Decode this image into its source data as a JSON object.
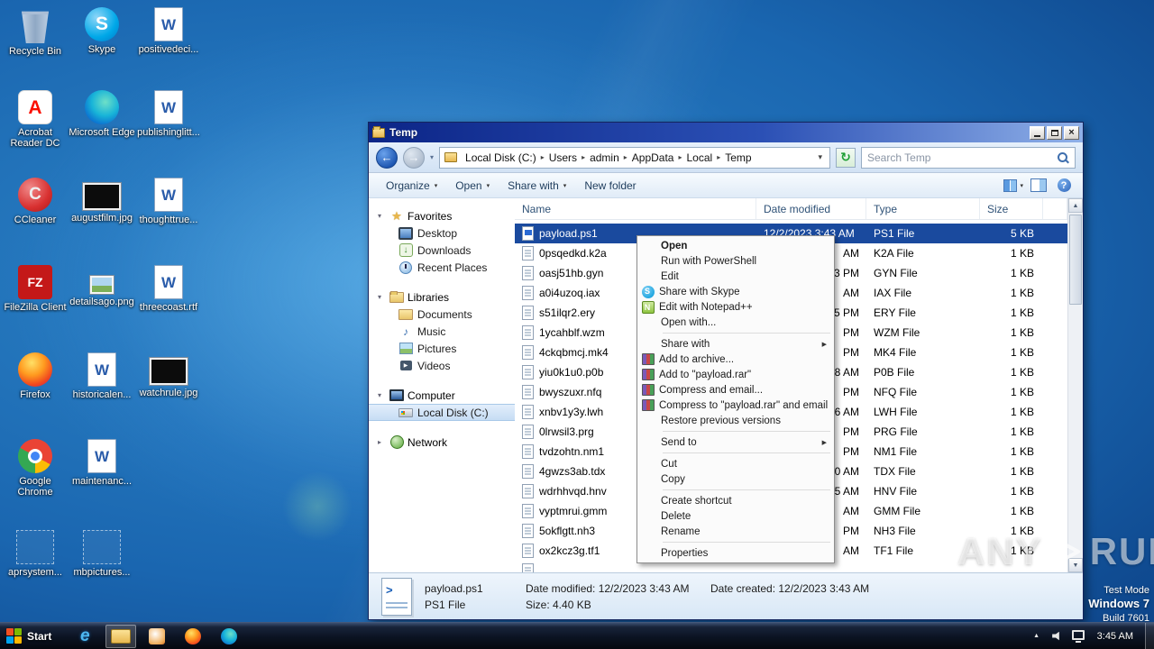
{
  "colors": {
    "selection": "#1a4a9e",
    "titlebar_left": "#0c2587",
    "titlebar_right": "#8fb0e8",
    "taskbar": "#0b1322"
  },
  "desktop": {
    "icons": [
      {
        "label": "Recycle Bin",
        "kind": "recycle",
        "col": 0,
        "row": 0
      },
      {
        "label": "Skype",
        "kind": "skype",
        "col": 1,
        "row": 0
      },
      {
        "label": "positivedeci...",
        "kind": "word",
        "col": 2,
        "row": 0
      },
      {
        "label": "Acrobat Reader DC",
        "kind": "acrobat",
        "col": 0,
        "row": 1
      },
      {
        "label": "Microsoft Edge",
        "kind": "edge",
        "col": 1,
        "row": 1
      },
      {
        "label": "publishinglitt...",
        "kind": "word",
        "col": 2,
        "row": 1
      },
      {
        "label": "CCleaner",
        "kind": "ccleaner",
        "col": 0,
        "row": 2
      },
      {
        "label": "augustfilm.jpg",
        "kind": "imgblack",
        "col": 1,
        "row": 2
      },
      {
        "label": "thoughttrue...",
        "kind": "word",
        "col": 2,
        "row": 2
      },
      {
        "label": "FileZilla Client",
        "kind": "filezilla",
        "col": 0,
        "row": 3
      },
      {
        "label": "detailsago.png",
        "kind": "imgsmall",
        "col": 1,
        "row": 3
      },
      {
        "label": "threecoast.rtf",
        "kind": "word",
        "col": 2,
        "row": 3
      },
      {
        "label": "Firefox",
        "kind": "firefox",
        "col": 0,
        "row": 4
      },
      {
        "label": "historicalen...",
        "kind": "word",
        "col": 1,
        "row": 4
      },
      {
        "label": "watchrule.jpg",
        "kind": "imgblack",
        "col": 2,
        "row": 4
      },
      {
        "label": "Google Chrome",
        "kind": "chrome",
        "col": 0,
        "row": 5
      },
      {
        "label": "maintenanc...",
        "kind": "word",
        "col": 1,
        "row": 5
      },
      {
        "label": "aprsystem...",
        "kind": "ghost",
        "col": 0,
        "row": 6
      },
      {
        "label": "mbpictures...",
        "kind": "ghost",
        "col": 1,
        "row": 6
      }
    ]
  },
  "window": {
    "title": "Temp",
    "controls": [
      "minimize",
      "maximize",
      "close"
    ],
    "address": [
      "Local Disk (C:)",
      "Users",
      "admin",
      "AppData",
      "Local",
      "Temp"
    ],
    "search_placeholder": "Search Temp",
    "toolbar": [
      {
        "label": "Organize",
        "caret": true
      },
      {
        "label": "Open",
        "caret": true
      },
      {
        "label": "Share with",
        "caret": true
      },
      {
        "label": "New folder",
        "caret": false
      }
    ],
    "view_buttons": [
      "views",
      "preview-pane",
      "help"
    ],
    "sidebar": [
      {
        "label": "Favorites",
        "icon": "star",
        "expanded": true,
        "items": [
          {
            "label": "Desktop",
            "icon": "desktop"
          },
          {
            "label": "Downloads",
            "icon": "downloads"
          },
          {
            "label": "Recent Places",
            "icon": "recent"
          }
        ]
      },
      {
        "label": "Libraries",
        "icon": "libraries",
        "expanded": true,
        "items": [
          {
            "label": "Documents",
            "icon": "folder"
          },
          {
            "label": "Music",
            "icon": "music"
          },
          {
            "label": "Pictures",
            "icon": "pictures"
          },
          {
            "label": "Videos",
            "icon": "videos"
          }
        ]
      },
      {
        "label": "Computer",
        "icon": "computer",
        "expanded": true,
        "items": [
          {
            "label": "Local Disk (C:)",
            "icon": "disk",
            "selected": true
          }
        ]
      },
      {
        "label": "Network",
        "icon": "network",
        "expanded": false,
        "items": []
      }
    ],
    "columns": [
      "Name",
      "Date modified",
      "Type",
      "Size"
    ],
    "files": [
      {
        "name": "payload.ps1",
        "date": "12/2/2023 3:43 AM",
        "type": "PS1 File",
        "size": "5 KB",
        "selected": true,
        "icon": "ps1"
      },
      {
        "name": "0psqedkd.k2a",
        "date": "AM",
        "type": "K2A File",
        "size": "1 KB"
      },
      {
        "name": "oasj51hb.gyn",
        "date": "3 PM",
        "type": "GYN File",
        "size": "1 KB"
      },
      {
        "name": "a0i4uzoq.iax",
        "date": "AM",
        "type": "IAX File",
        "size": "1 KB"
      },
      {
        "name": "s51ilqr2.ery",
        "date": "5 PM",
        "type": "ERY File",
        "size": "1 KB"
      },
      {
        "name": "1ycahblf.wzm",
        "date": "PM",
        "type": "WZM File",
        "size": "1 KB"
      },
      {
        "name": "4ckqbmcj.mk4",
        "date": "PM",
        "type": "MK4 File",
        "size": "1 KB"
      },
      {
        "name": "yiu0k1u0.p0b",
        "date": "8 AM",
        "type": "P0B File",
        "size": "1 KB"
      },
      {
        "name": "bwyszuxr.nfq",
        "date": "PM",
        "type": "NFQ File",
        "size": "1 KB"
      },
      {
        "name": "xnbv1y3y.lwh",
        "date": "6 AM",
        "type": "LWH File",
        "size": "1 KB"
      },
      {
        "name": "0lrwsil3.prg",
        "date": "PM",
        "type": "PRG File",
        "size": "1 KB"
      },
      {
        "name": "tvdzohtn.nm1",
        "date": "PM",
        "type": "NM1 File",
        "size": "1 KB"
      },
      {
        "name": "4gwzs3ab.tdx",
        "date": "0 AM",
        "type": "TDX File",
        "size": "1 KB"
      },
      {
        "name": "wdrhhvqd.hnv",
        "date": "35 AM",
        "type": "HNV File",
        "size": "1 KB"
      },
      {
        "name": "vyptmrui.gmm",
        "date": "AM",
        "type": "GMM File",
        "size": "1 KB"
      },
      {
        "name": "5okflgtt.nh3",
        "date": "PM",
        "type": "NH3 File",
        "size": "1 KB"
      },
      {
        "name": "ox2kcz3g.tf1",
        "date": "AM",
        "type": "TF1 File",
        "size": "1 KB"
      }
    ],
    "details": {
      "name": "payload.ps1",
      "type": "PS1 File",
      "date_modified": "Date modified: 12/2/2023 3:43 AM",
      "date_created": "Date created: 12/2/2023 3:43 AM",
      "size": "Size: 4.40 KB"
    }
  },
  "context_menu": {
    "items": [
      {
        "label": "Open",
        "bold": true
      },
      {
        "label": "Run with PowerShell"
      },
      {
        "label": "Edit"
      },
      {
        "label": "Share with Skype",
        "icon": "skype"
      },
      {
        "label": "Edit with Notepad++",
        "icon": "npp"
      },
      {
        "label": "Open with..."
      },
      {
        "sep": true
      },
      {
        "label": "Share with",
        "submenu": true
      },
      {
        "label": "Add to archive...",
        "icon": "rar"
      },
      {
        "label": "Add to \"payload.rar\"",
        "icon": "rar"
      },
      {
        "label": "Compress and email...",
        "icon": "rar"
      },
      {
        "label": "Compress to \"payload.rar\" and email",
        "icon": "rar"
      },
      {
        "label": "Restore previous versions"
      },
      {
        "sep": true
      },
      {
        "label": "Send to",
        "submenu": true
      },
      {
        "sep": true
      },
      {
        "label": "Cut"
      },
      {
        "label": "Copy"
      },
      {
        "sep": true
      },
      {
        "label": "Create shortcut"
      },
      {
        "label": "Delete"
      },
      {
        "label": "Rename"
      },
      {
        "sep": true
      },
      {
        "label": "Properties"
      }
    ]
  },
  "taskbar": {
    "start_label": "Start",
    "icons": [
      {
        "name": "internet-explorer"
      },
      {
        "name": "windows-explorer",
        "active": true
      },
      {
        "name": "media-app"
      },
      {
        "name": "firefox"
      },
      {
        "name": "edge"
      }
    ],
    "tray_icons": [
      "hidden-icons",
      "volume",
      "network"
    ],
    "clock": "3:45 AM"
  },
  "watermark": {
    "brand_left": "ANY",
    "brand_right": "RUN",
    "mode": "Test Mode",
    "os": "Windows 7",
    "build": "Build 7601"
  }
}
